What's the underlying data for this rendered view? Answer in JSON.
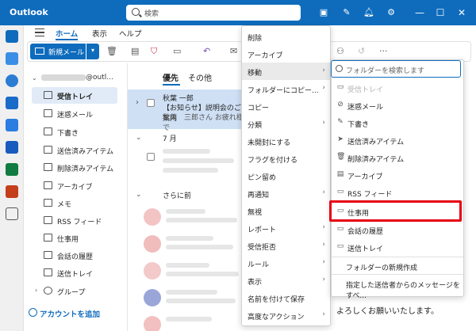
{
  "app": {
    "title": "Outlook"
  },
  "search": {
    "placeholder": "検索"
  },
  "tabs": [
    {
      "label": "ホーム"
    },
    {
      "label": "表示"
    },
    {
      "label": "ヘルプ"
    }
  ],
  "ribbon": {
    "new_mail": "新規メール",
    "more": "···"
  },
  "account": {
    "suffix": "@outl..."
  },
  "folders": [
    {
      "label": "受信トレイ",
      "selected": true
    },
    {
      "label": "迷惑メール"
    },
    {
      "label": "下書き"
    },
    {
      "label": "送信済みアイテム"
    },
    {
      "label": "削除済みアイテム"
    },
    {
      "label": "アーカイブ"
    },
    {
      "label": "メモ"
    },
    {
      "label": "RSS フィード"
    },
    {
      "label": "仕事用"
    },
    {
      "label": "会話の履歴"
    },
    {
      "label": "送信トレイ"
    },
    {
      "label": "グループ"
    }
  ],
  "add_account": "アカウントを追加",
  "message_list": {
    "tab_focused": "優先",
    "tab_other": "その他",
    "selected": {
      "sender": "秋葉 一郎",
      "subject": "【お知らせ】説明会のご案内",
      "preview": "秋葉　三郎さん お疲れ様で"
    },
    "group_july": "7 月",
    "group_earlier": "さらに前"
  },
  "reading_pane": {
    "text": "よろしくお願いいたします。"
  },
  "context_menu": [
    {
      "label": "削除"
    },
    {
      "label": "アーカイブ"
    },
    {
      "label": "移動",
      "submenu": true,
      "active": true
    },
    {
      "label": "フォルダーにコピー...",
      "submenu": true
    },
    {
      "label": "コピー"
    },
    {
      "label": "分類",
      "submenu": true
    },
    {
      "label": "未開封にする"
    },
    {
      "label": "フラグを付ける"
    },
    {
      "label": "ピン留め"
    },
    {
      "label": "再通知",
      "submenu": true
    },
    {
      "label": "無視"
    },
    {
      "label": "レポート",
      "submenu": true
    },
    {
      "label": "受信拒否",
      "submenu": true
    },
    {
      "label": "ルール",
      "submenu": true
    },
    {
      "label": "表示",
      "submenu": true
    },
    {
      "label": "名前を付けて保存"
    },
    {
      "label": "高度なアクション",
      "submenu": true
    }
  ],
  "move_submenu": {
    "search_placeholder": "フォルダーを検索します",
    "items": [
      {
        "label": "受信トレイ",
        "disabled": true,
        "icon": "inbox-icon"
      },
      {
        "label": "迷惑メール",
        "icon": "junk-icon"
      },
      {
        "label": "下書き",
        "icon": "draft-icon"
      },
      {
        "label": "送信済みアイテム",
        "icon": "sent-icon"
      },
      {
        "label": "削除済みアイテム",
        "icon": "trash-icon"
      },
      {
        "label": "アーカイブ",
        "icon": "archive-icon"
      },
      {
        "label": "RSS フィード",
        "icon": "rss-icon"
      },
      {
        "label": "仕事用",
        "icon": "folder-icon",
        "highlighted": true
      },
      {
        "label": "会話の履歴",
        "icon": "folder-icon"
      },
      {
        "label": "送信トレイ",
        "icon": "outbox-icon"
      }
    ],
    "new_folder": "フォルダーの新規作成",
    "move_all": "指定した送信者からのメッセージをすべ..."
  },
  "colors": {
    "accent": "#0f6cbd",
    "highlight_box": "#e60012"
  }
}
